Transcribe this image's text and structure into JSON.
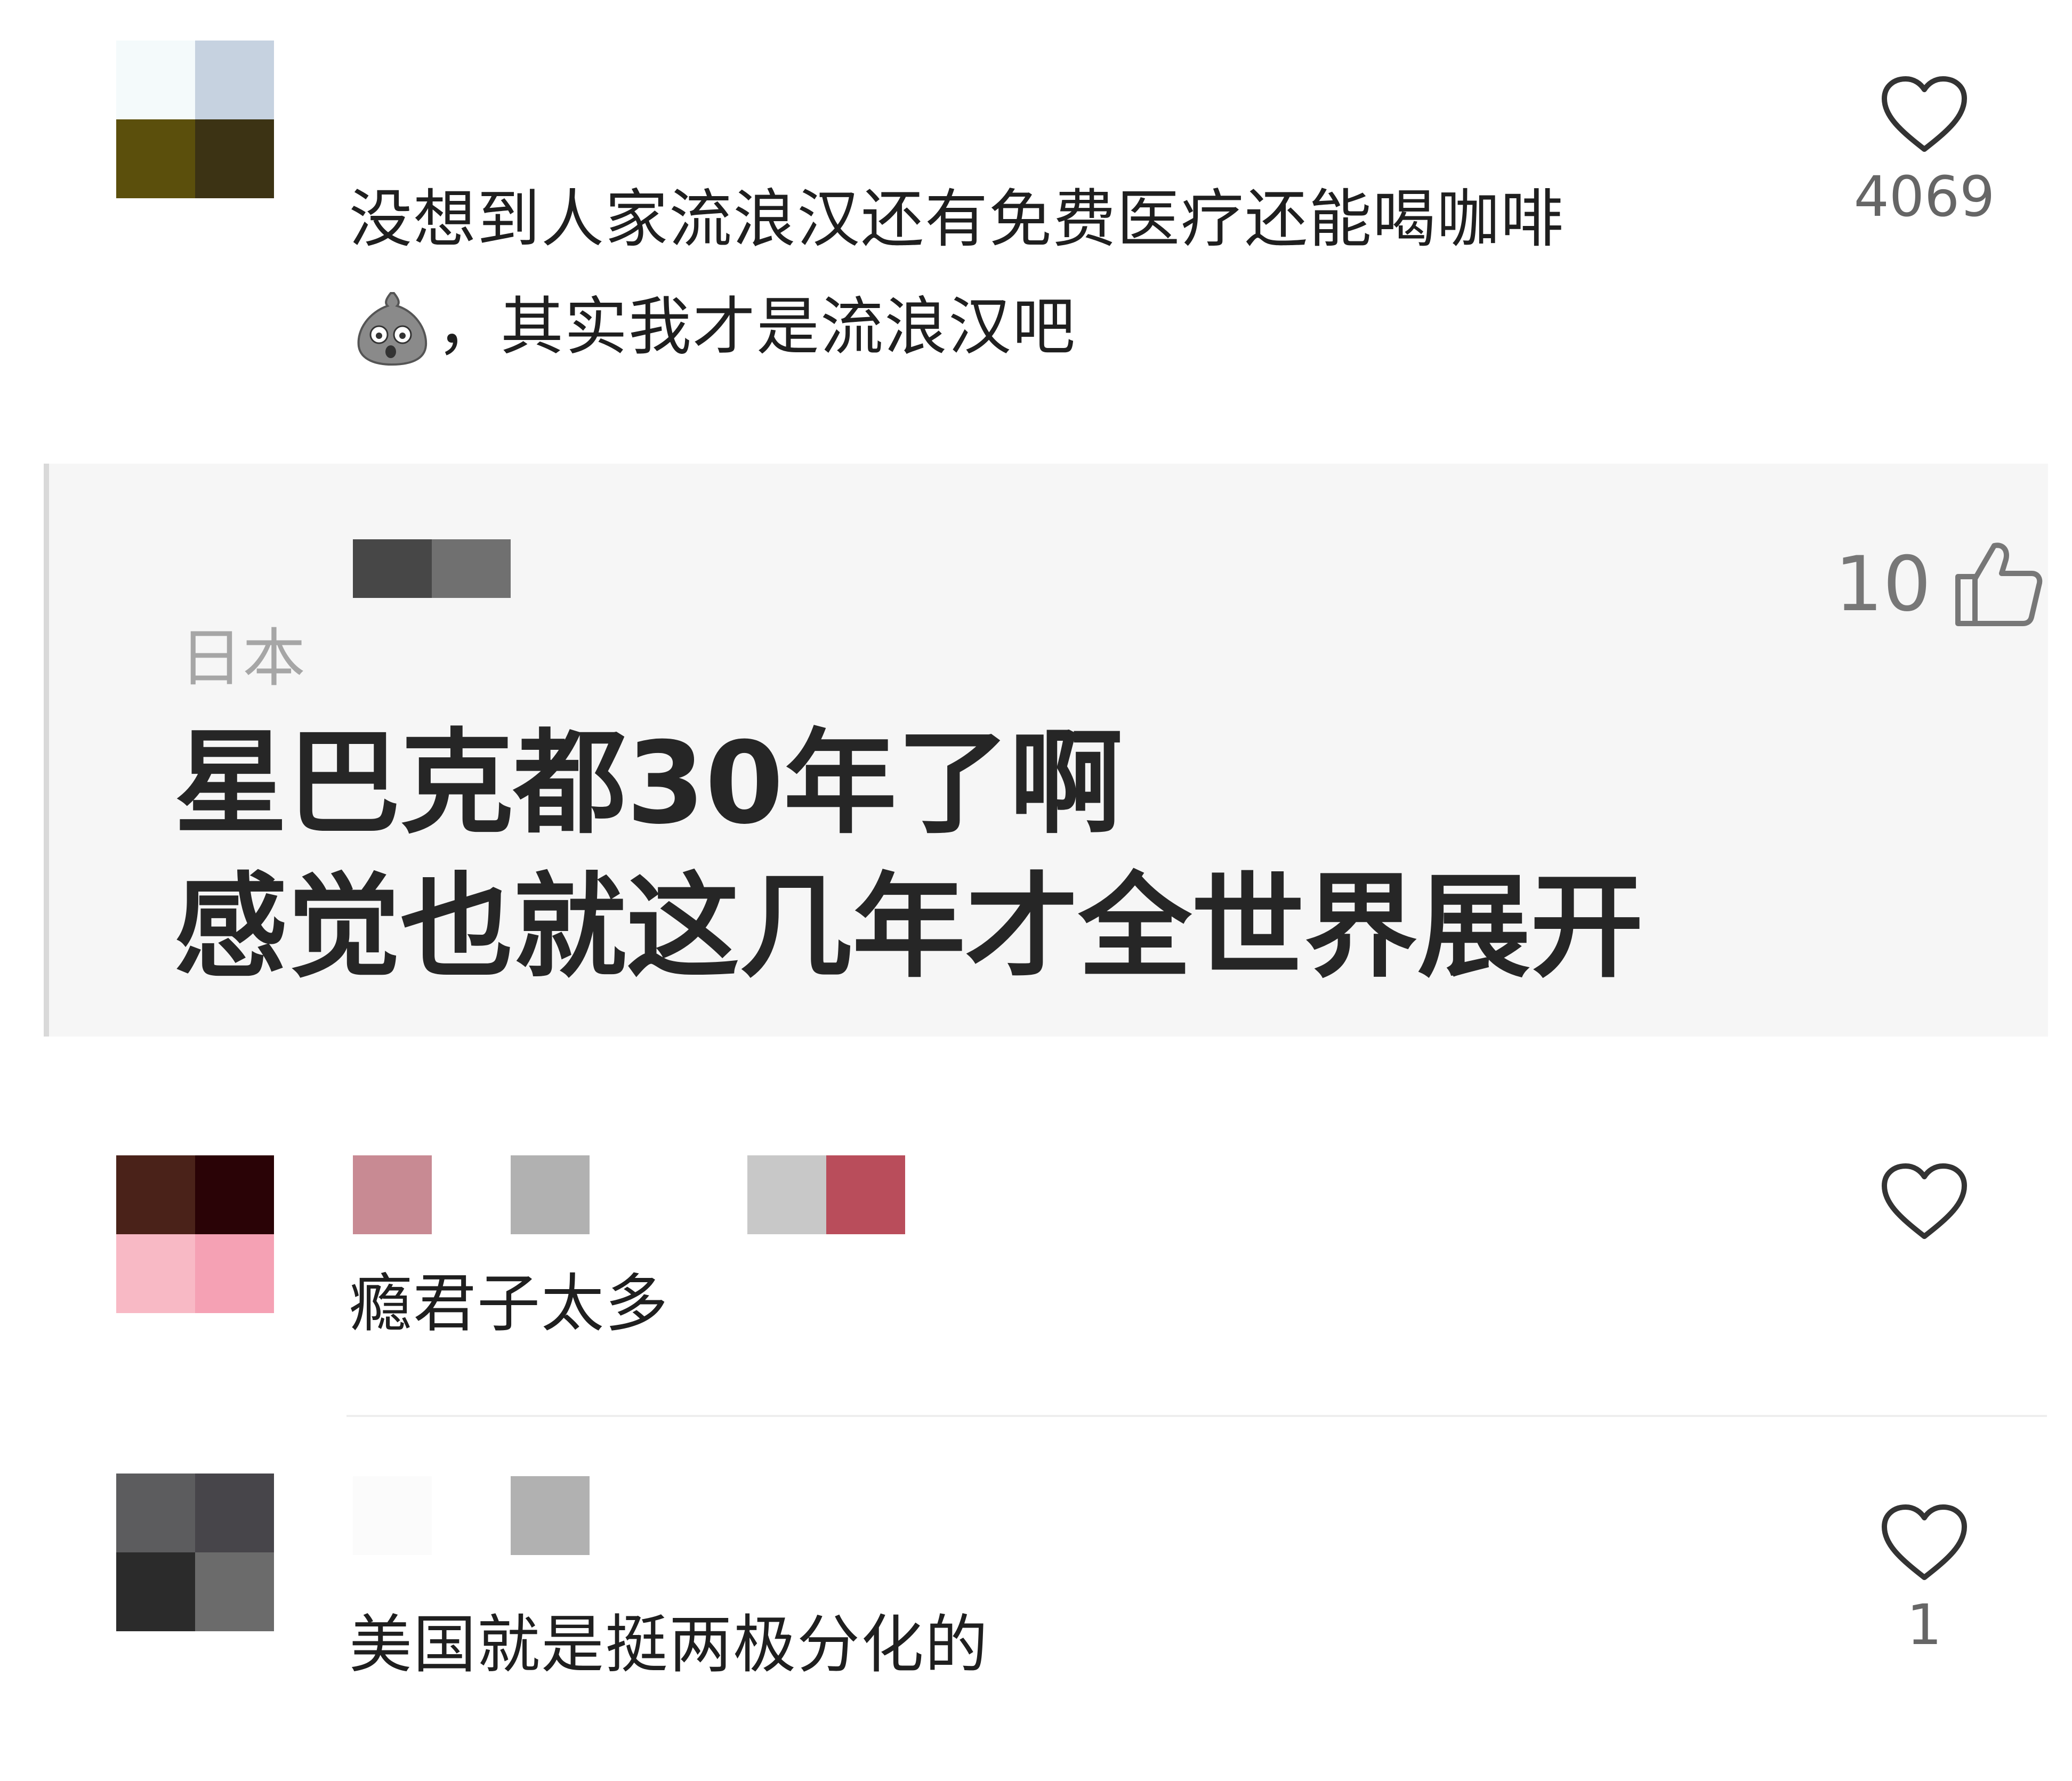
{
  "comments": [
    {
      "avatar_colors": [
        "#f4fafb",
        "#c6d2e0",
        "#5b4f0c",
        "#3c3314"
      ],
      "text_line1": "没想到人家流浪汉还有免费医疗还能喝咖啡",
      "emoji": "sack-emoji",
      "text_line2": "，其实我才是流浪汉吧",
      "likes": "4069",
      "like_icon": "heart-icon"
    },
    {
      "avatar_colors": [
        "#4a2219",
        "#2a0306",
        "#f8b9c5",
        "#f5a1b4"
      ],
      "username_colors": [
        "#c88a93",
        "#ffffff",
        "#b1b1b1",
        "#ffffff",
        "#ffffff",
        "#c8c8c8",
        "#b94d5b"
      ],
      "text_line1": "瘾君子太多",
      "likes": "",
      "like_icon": "heart-icon"
    },
    {
      "avatar_colors": [
        "#5c5c5e",
        "#47454a",
        "#2b2b2b",
        "#6b6b6b"
      ],
      "username_colors": [
        "#fbfbfb",
        "#ffffff",
        "#b1b1b1"
      ],
      "text_line1": "美国就是挺两极分化的",
      "likes": "1",
      "like_icon": "heart-icon"
    }
  ],
  "quote": {
    "username_colors": [
      "#474747",
      "#707070"
    ],
    "location": "日本",
    "line1": "星巴克都30年了啊",
    "line2": "感觉也就这几年才全世界展开",
    "likes": "10",
    "like_icon": "thumbs-up-icon"
  }
}
